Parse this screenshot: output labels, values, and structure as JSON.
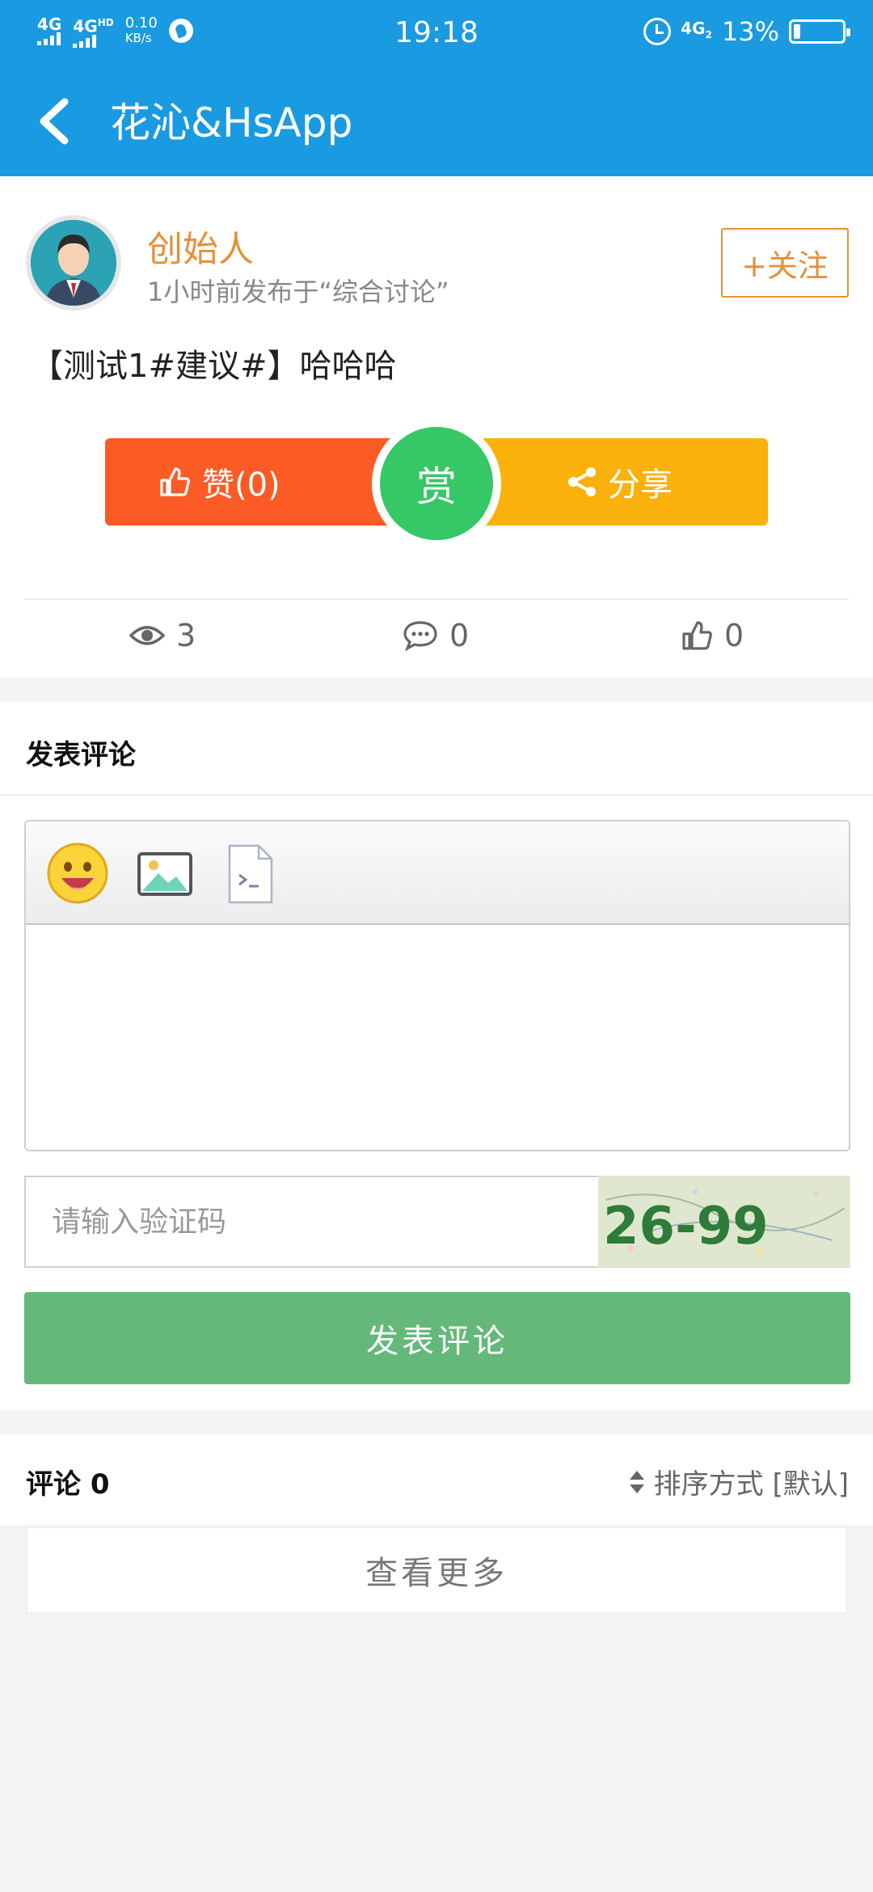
{
  "status_bar": {
    "signal1": "4G",
    "signal2": "4G",
    "signal2_sup": "HD",
    "speed_value": "0.10",
    "speed_unit": "KB/s",
    "time": "19:18",
    "network": "4G",
    "network_sub": "2",
    "battery_percent": "13%",
    "battery_level": 0.13
  },
  "nav": {
    "title": "花沁&HsApp"
  },
  "post": {
    "author": "创始人",
    "meta": "1小时前发布于“综合讨论”",
    "follow_label": "+关注",
    "body": "【测试1#建议#】哈哈哈",
    "like_label": "赞(0)",
    "reward_label": "赏",
    "share_label": "分享",
    "stats": {
      "views": "3",
      "comments": "0",
      "likes": "0"
    }
  },
  "composer": {
    "title": "发表评论",
    "toolbar_icons": [
      "emoji-icon",
      "image-icon",
      "code-icon"
    ],
    "captcha_placeholder": "请输入验证码",
    "captcha_text": "26-99",
    "submit_label": "发表评论"
  },
  "comments": {
    "title": "评论 0",
    "sort_label": "排序方式 [默认]",
    "more_label": "查看更多"
  },
  "colors": {
    "header": "#1a9ae0",
    "author": "#e4913a",
    "like": "#fc5b26",
    "reward": "#36c766",
    "share": "#fbb10c",
    "submit": "#63b87a"
  }
}
